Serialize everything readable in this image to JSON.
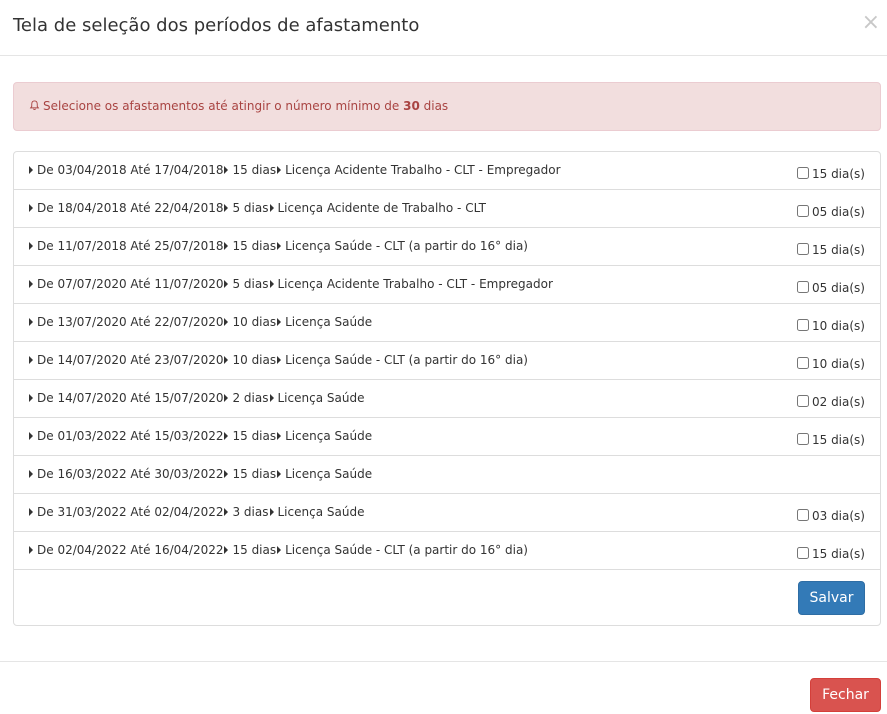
{
  "header": {
    "title": "Tela de seleção dos períodos de afastamento",
    "close_glyph": "×"
  },
  "alert": {
    "text_before": "Selecione os afastamentos até atingir o número mínimo de",
    "highlight": "30",
    "text_after": "dias",
    "icon": "bell-icon"
  },
  "rows": [
    {
      "label": "De 03/04/2018 Até 17/04/2018",
      "days": "15 dias",
      "type": "Licença Acidente Trabalho - CLT - Empregador",
      "check_label": "15 dia(s)",
      "has_checkbox": true
    },
    {
      "label": "De 18/04/2018 Até 22/04/2018",
      "days": "5 dias",
      "type": "Licença Acidente de Trabalho - CLT",
      "check_label": "05 dia(s)",
      "has_checkbox": true
    },
    {
      "label": "De 11/07/2018 Até 25/07/2018",
      "days": "15 dias",
      "type": "Licença Saúde - CLT (a partir do 16° dia)",
      "check_label": "15 dia(s)",
      "has_checkbox": true
    },
    {
      "label": "De 07/07/2020 Até 11/07/2020",
      "days": "5 dias",
      "type": "Licença Acidente Trabalho - CLT - Empregador",
      "check_label": "05 dia(s)",
      "has_checkbox": true
    },
    {
      "label": "De 13/07/2020 Até 22/07/2020",
      "days": "10 dias",
      "type": "Licença Saúde",
      "check_label": "10 dia(s)",
      "has_checkbox": true
    },
    {
      "label": "De 14/07/2020 Até 23/07/2020",
      "days": "10 dias",
      "type": "Licença Saúde - CLT (a partir do 16° dia)",
      "check_label": "10 dia(s)",
      "has_checkbox": true
    },
    {
      "label": "De 14/07/2020 Até 15/07/2020",
      "days": "2 dias",
      "type": "Licença Saúde",
      "check_label": "02 dia(s)",
      "has_checkbox": true
    },
    {
      "label": "De 01/03/2022 Até 15/03/2022",
      "days": "15 dias",
      "type": "Licença Saúde",
      "check_label": "15 dia(s)",
      "has_checkbox": true
    },
    {
      "label": "De 16/03/2022 Até 30/03/2022",
      "days": "15 dias",
      "type": "Licença Saúde",
      "check_label": "",
      "has_checkbox": false
    },
    {
      "label": "De 31/03/2022 Até 02/04/2022",
      "days": "3 dias",
      "type": "Licença Saúde",
      "check_label": "03 dia(s)",
      "has_checkbox": true
    },
    {
      "label": "De 02/04/2022 Até 16/04/2022",
      "days": "15 dias",
      "type": "Licença Saúde - CLT (a partir do 16° dia)",
      "check_label": "15 dia(s)",
      "has_checkbox": true
    }
  ],
  "buttons": {
    "save": "Salvar",
    "close": "Fechar"
  },
  "colors": {
    "alert_bg": "#f2dede",
    "alert_text": "#a94442",
    "primary": "#337ab7",
    "danger": "#d9534f"
  }
}
